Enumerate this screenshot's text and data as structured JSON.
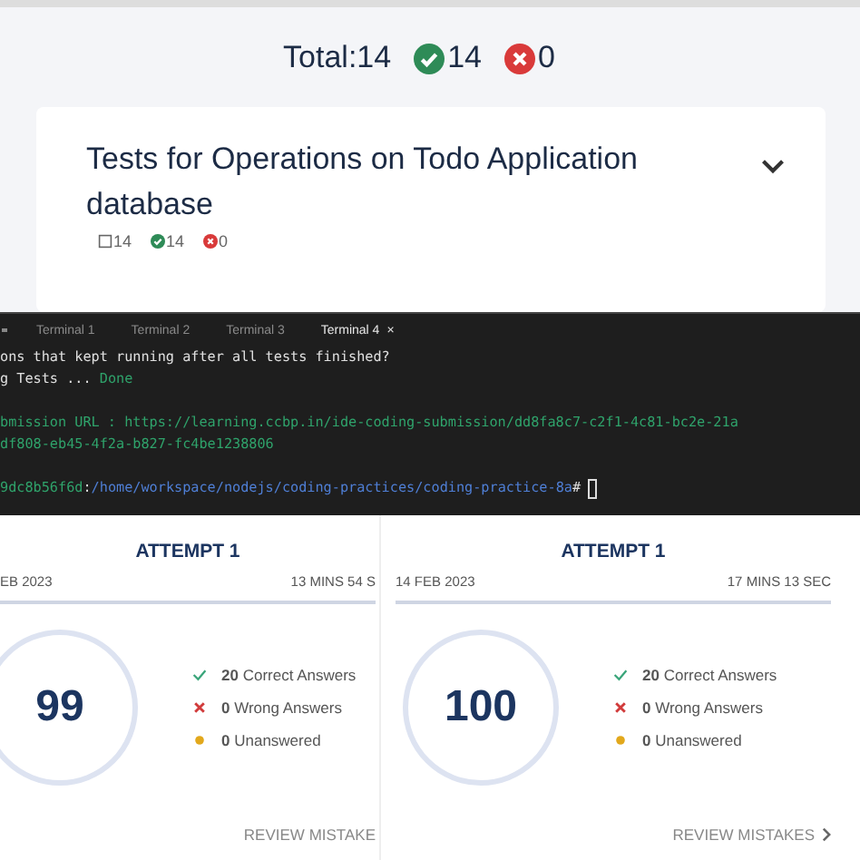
{
  "summary": {
    "total": "Total:14",
    "passed": "14",
    "failed": "0"
  },
  "suite": {
    "title": "Tests for Operations on Todo Application database",
    "total": "14",
    "passed": "14",
    "failed": "0"
  },
  "terminal": {
    "tabs": [
      {
        "label": "Terminal 1",
        "selected": false
      },
      {
        "label": "Terminal 2",
        "selected": false
      },
      {
        "label": "Terminal 3",
        "selected": false
      },
      {
        "label": "Terminal 4",
        "selected": true
      }
    ],
    "close": "×",
    "lines": [
      {
        "kind": "output",
        "segments": [
          {
            "kind": "plain",
            "text": "ons that kept running after all tests finished?"
          }
        ]
      },
      {
        "kind": "output",
        "segments": [
          {
            "kind": "plain",
            "text": "g Tests ... "
          },
          {
            "kind": "success",
            "text": "Done"
          }
        ]
      },
      {
        "kind": "blank"
      },
      {
        "kind": "output",
        "segments": [
          {
            "kind": "success",
            "text": "bmission URL : https://learning.ccbp.in/ide-coding-submission/dd8fa8c7-c2f1-4c81-bc2e-21a"
          }
        ]
      },
      {
        "kind": "output",
        "segments": [
          {
            "kind": "success",
            "text": "df808-eb45-4f2a-b827-fc4be1238806"
          }
        ]
      },
      {
        "kind": "blank"
      },
      {
        "kind": "output",
        "segments": [
          {
            "kind": "success",
            "text": "9dc8b56f6d"
          },
          {
            "kind": "plain",
            "text": ":"
          },
          {
            "kind": "path",
            "text": "/home/workspace/nodejs/coding-practices/coding-practice-8a"
          },
          {
            "kind": "plain",
            "text": "#"
          }
        ],
        "cursor": true
      }
    ]
  },
  "attempts": [
    {
      "title": "ATTEMPT 1",
      "date": "EB 2023",
      "duration": "13 MINS 54 S",
      "score": "99",
      "cut": true,
      "stats": [
        {
          "kind": "correct",
          "count": "20",
          "label": "Correct Answers"
        },
        {
          "kind": "wrong",
          "count": "0",
          "label": "Wrong Answers"
        },
        {
          "kind": "unanswered",
          "count": "0",
          "label": "Unanswered"
        }
      ],
      "review": "REVIEW MISTAKE",
      "arrow": false
    },
    {
      "title": "ATTEMPT 1",
      "date": "14 FEB 2023",
      "duration": "17 MINS 13 SEC",
      "score": "100",
      "cut": false,
      "stats": [
        {
          "kind": "correct",
          "count": "20",
          "label": "Correct Answers"
        },
        {
          "kind": "wrong",
          "count": "0",
          "label": "Wrong Answers"
        },
        {
          "kind": "unanswered",
          "count": "0",
          "label": "Unanswered"
        }
      ],
      "review": "REVIEW MISTAKES",
      "arrow": true
    }
  ]
}
